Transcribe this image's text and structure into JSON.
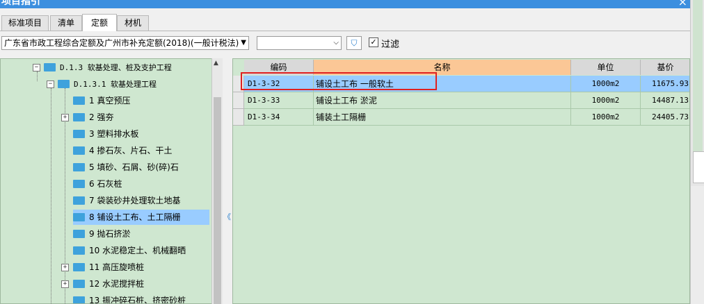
{
  "window": {
    "title": "项目指引",
    "close_glyph": "×"
  },
  "tabs": [
    {
      "label": "标准项目",
      "active": false
    },
    {
      "label": "清单",
      "active": false
    },
    {
      "label": "定额",
      "active": true
    },
    {
      "label": "材机",
      "active": false
    }
  ],
  "toolbar": {
    "quota_library": "广东省市政工程综合定额及广州市补充定额(2018)(一般计税法)",
    "second_select_value": "",
    "filter_label": "过滤",
    "filter_checked": true
  },
  "tree": {
    "items": [
      {
        "label": "D.1.3 软基处理、桩及支护工程",
        "expander": "−"
      },
      {
        "label": "D.1.3.1 软基处理工程",
        "expander": "−"
      },
      {
        "label": "1 真空预压",
        "expander": ""
      },
      {
        "label": "2 强夯",
        "expander": "+"
      },
      {
        "label": "3 塑料排水板",
        "expander": ""
      },
      {
        "label": "4 掺石灰、片石、干土",
        "expander": ""
      },
      {
        "label": "5 填砂、石屑、砂(碎)石",
        "expander": ""
      },
      {
        "label": "6 石灰桩",
        "expander": ""
      },
      {
        "label": "7 袋装砂井处理软土地基",
        "expander": ""
      },
      {
        "label": "8 铺设土工布、土工隔栅",
        "expander": "",
        "selected": true
      },
      {
        "label": "9 抛石挤淤",
        "expander": ""
      },
      {
        "label": "10 水泥稳定土、机械翻晒",
        "expander": ""
      },
      {
        "label": "11 高压旋喷桩",
        "expander": "+"
      },
      {
        "label": "12 水泥搅拌桩",
        "expander": "+"
      },
      {
        "label": "13 振冲碎石桩、挤密砂桩",
        "expander": ""
      }
    ]
  },
  "grid": {
    "columns": [
      "编码",
      "名称",
      "单位",
      "基价"
    ],
    "rows": [
      {
        "code": "D1-3-32",
        "name": "铺设土工布 一般软土",
        "unit": "1000m2",
        "price": "11675.93"
      },
      {
        "code": "D1-3-33",
        "name": "铺设土工布 淤泥",
        "unit": "1000m2",
        "price": "14487.13"
      },
      {
        "code": "D1-3-34",
        "name": "铺装土工隔栅",
        "unit": "1000m2",
        "price": "24405.73"
      }
    ]
  },
  "colors": {
    "panel_green": "#cfe7d0",
    "selection_blue": "#99ccff",
    "name_header_orange": "#fbc796",
    "annotation_red": "#e02020"
  }
}
